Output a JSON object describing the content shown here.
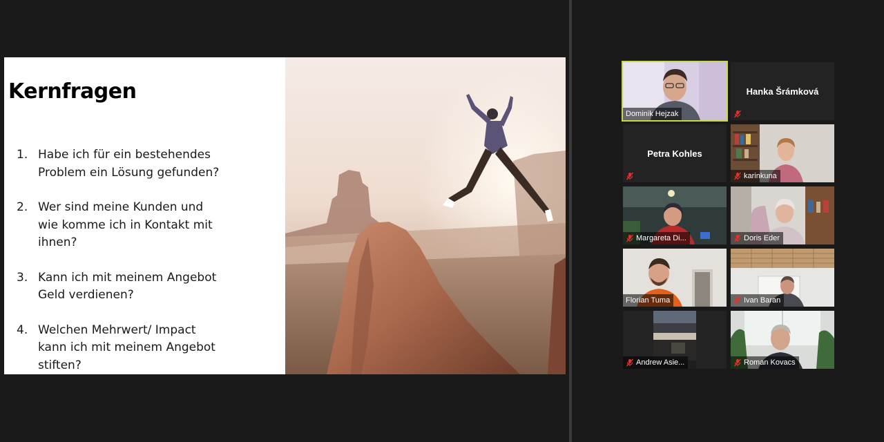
{
  "slide": {
    "title": "Kernfragen",
    "items": [
      {
        "number": "1.",
        "text_lines": [
          "Habe ich für ein bestehendes",
          "Problem ein Lösung gefunden?"
        ]
      },
      {
        "number": "2.",
        "text_lines": [
          "Wer sind meine Kunden und",
          "wie komme ich in Kontakt mit",
          "ihnen?"
        ]
      },
      {
        "number": "3.",
        "text_lines": [
          "Kann ich mit meinem Angebot",
          "Geld verdienen?"
        ]
      },
      {
        "number": "4.",
        "text_lines": [
          "Welchen Mehrwert/ Impact",
          "kann ich mit meinem Angebot",
          "stiften?"
        ]
      }
    ]
  },
  "participants": [
    {
      "name": "Dominik Hejzak",
      "video": true,
      "muted": false,
      "active_speaker": true
    },
    {
      "name": "Hanka Šrámková",
      "video": false,
      "muted": true,
      "active_speaker": false
    },
    {
      "name": "Petra Kohles",
      "video": false,
      "muted": true,
      "active_speaker": false
    },
    {
      "name": "karinkuna",
      "video": true,
      "muted": true,
      "active_speaker": false
    },
    {
      "name": "Margareta Di...",
      "video": true,
      "muted": true,
      "active_speaker": false
    },
    {
      "name": "Doris Eder",
      "video": true,
      "muted": true,
      "active_speaker": false
    },
    {
      "name": "Florian Tuma",
      "video": true,
      "muted": false,
      "active_speaker": false
    },
    {
      "name": "Ivan Baran",
      "video": true,
      "muted": true,
      "active_speaker": false
    },
    {
      "name": "Andrew Asie...",
      "video": true,
      "muted": true,
      "active_speaker": false
    },
    {
      "name": "Roman Kovacs",
      "video": true,
      "muted": true,
      "active_speaker": false
    }
  ],
  "colors": {
    "background": "#1a1a1a",
    "active_speaker_border": "#c6d94a",
    "muted_icon": "#e0332d"
  },
  "icons": {
    "muted": "mic-off-icon"
  }
}
